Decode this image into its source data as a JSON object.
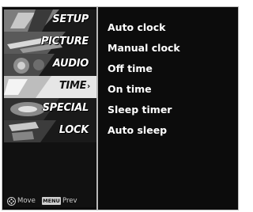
{
  "menu": {
    "items": [
      {
        "label": "SETUP",
        "icon": "setup-icon"
      },
      {
        "label": "PICTURE",
        "icon": "picture-icon"
      },
      {
        "label": "AUDIO",
        "icon": "audio-icon"
      },
      {
        "label": "TIME",
        "icon": "time-icon",
        "active": true
      },
      {
        "label": "SPECIAL",
        "icon": "special-icon"
      },
      {
        "label": "LOCK",
        "icon": "lock-icon"
      }
    ],
    "active_arrow": "›"
  },
  "submenu": {
    "options": [
      "Auto clock",
      "Manual clock",
      "Off time",
      "On time",
      "Sleep timer",
      "Auto sleep"
    ]
  },
  "footer": {
    "move_label": "Move",
    "menu_key": "MENU",
    "prev_label": "Prev"
  },
  "colors": {
    "background": "#0c0c0c",
    "active_item": "#e6e6e6",
    "text": "#ffffff"
  }
}
